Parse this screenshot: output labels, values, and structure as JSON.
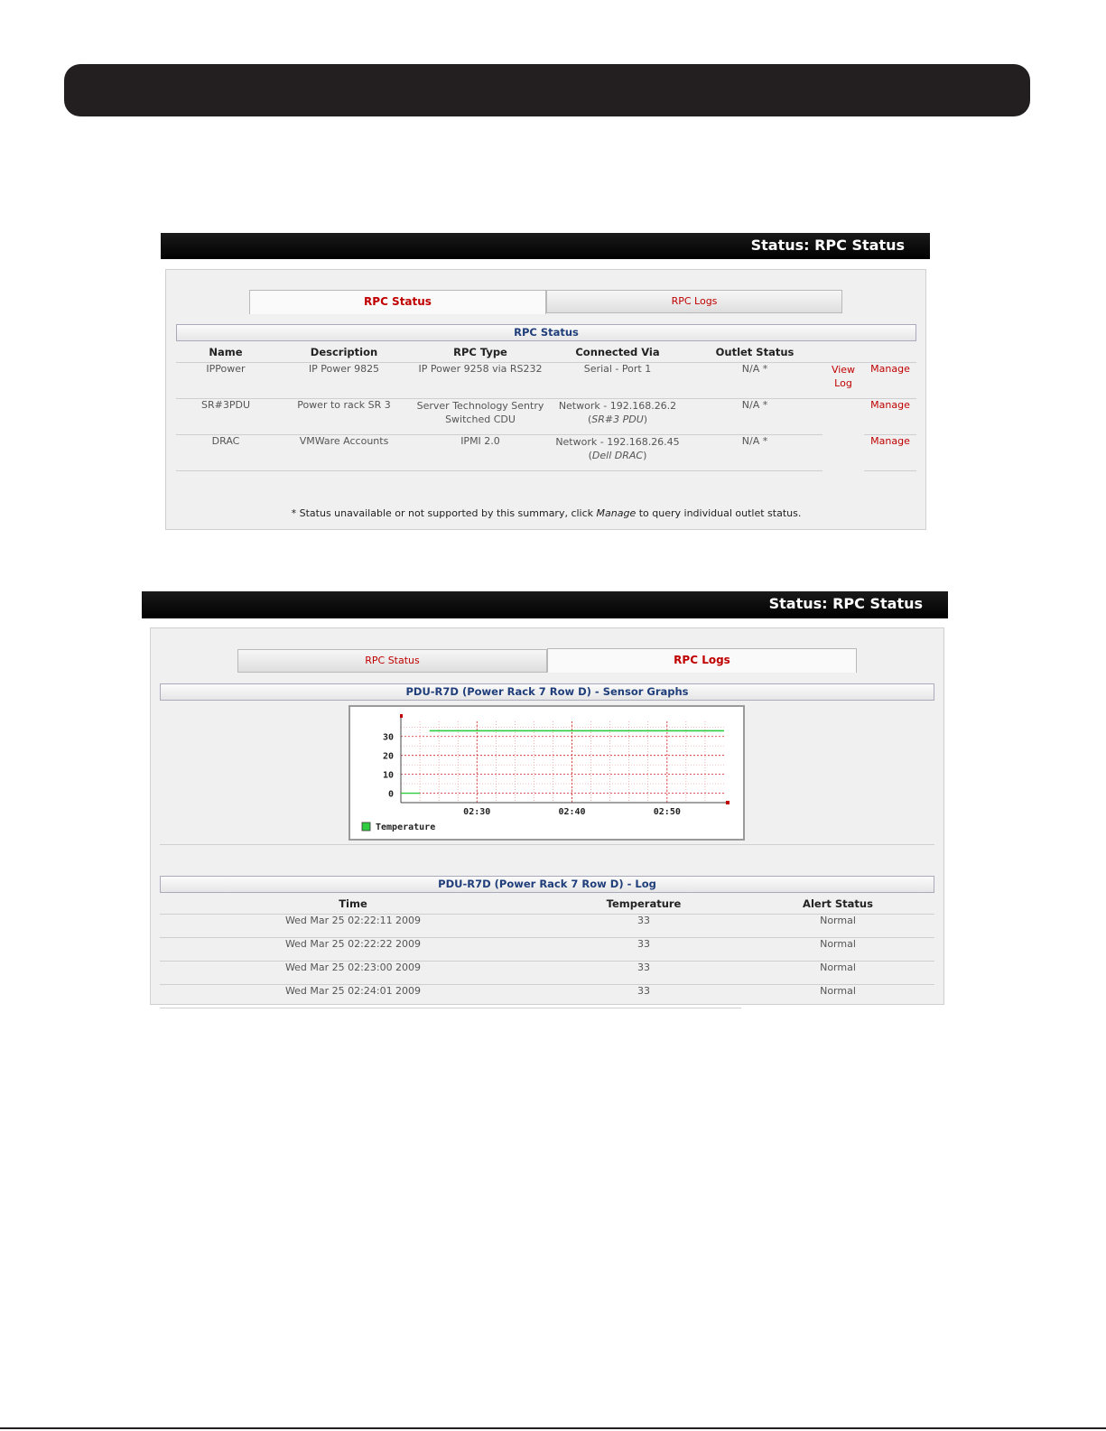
{
  "panel1": {
    "header": "Status: RPC Status",
    "tabs": [
      {
        "label": "RPC Status",
        "active": true
      },
      {
        "label": "RPC Logs",
        "active": false
      }
    ],
    "section_title": "RPC Status",
    "columns": [
      "Name",
      "Description",
      "RPC Type",
      "Connected Via",
      "Outlet Status"
    ],
    "rows": [
      {
        "name": "IPPower",
        "description": "IP Power 9825",
        "rpc_type": "IP Power 9258 via RS232",
        "connected_via": "Serial - Port 1",
        "connected_via_sub": "",
        "outlet_status": "N/A *",
        "view_log": "View Log",
        "manage": "Manage"
      },
      {
        "name": "SR#3PDU",
        "description": "Power to rack SR 3",
        "rpc_type": "Server Technology Sentry Switched CDU",
        "connected_via": "Network - 192.168.26.2",
        "connected_via_sub": "SR#3 PDU",
        "outlet_status": "N/A *",
        "view_log": "",
        "manage": "Manage"
      },
      {
        "name": "DRAC",
        "description": "VMWare Accounts",
        "rpc_type": "IPMI 2.0",
        "connected_via": "Network - 192.168.26.45",
        "connected_via_sub": "Dell DRAC",
        "outlet_status": "N/A *",
        "view_log": "",
        "manage": "Manage"
      }
    ],
    "footnote_pre": "* Status unavailable or not supported by this summary, click ",
    "footnote_link": "Manage",
    "footnote_post": " to query individual outlet status."
  },
  "panel2": {
    "header": "Status: RPC Status",
    "tabs": [
      {
        "label": "RPC Status",
        "active": false
      },
      {
        "label": "RPC Logs",
        "active": true
      }
    ],
    "graph_section_title": "PDU-R7D (Power Rack 7 Row D) - Sensor Graphs",
    "log_section_title": "PDU-R7D (Power Rack 7 Row D) - Log",
    "log_columns": [
      "Time",
      "Temperature",
      "Alert Status"
    ],
    "log_rows": [
      {
        "time": "Wed Mar 25 02:22:11 2009",
        "temperature": "33",
        "alert": "Normal"
      },
      {
        "time": "Wed Mar 25 02:22:22 2009",
        "temperature": "33",
        "alert": "Normal"
      },
      {
        "time": "Wed Mar 25 02:23:00 2009",
        "temperature": "33",
        "alert": "Normal"
      },
      {
        "time": "Wed Mar 25 02:24:01 2009",
        "temperature": "33",
        "alert": "Normal"
      }
    ]
  },
  "chart_data": {
    "type": "line",
    "title": "",
    "xlabel": "",
    "ylabel": "",
    "x_ticks": [
      "02:30",
      "02:40",
      "02:50"
    ],
    "y_ticks": [
      0,
      10,
      20,
      30
    ],
    "ylim": [
      -5,
      38
    ],
    "grid": true,
    "legend": "bottom-left",
    "series": [
      {
        "name": "Temperature",
        "color": "#2ecc40",
        "x": [
          "02:22",
          "02:24",
          "02:25",
          "02:30",
          "02:40",
          "02:50",
          "02:56"
        ],
        "values": [
          0,
          0,
          33,
          33,
          33,
          33,
          33
        ]
      }
    ]
  }
}
